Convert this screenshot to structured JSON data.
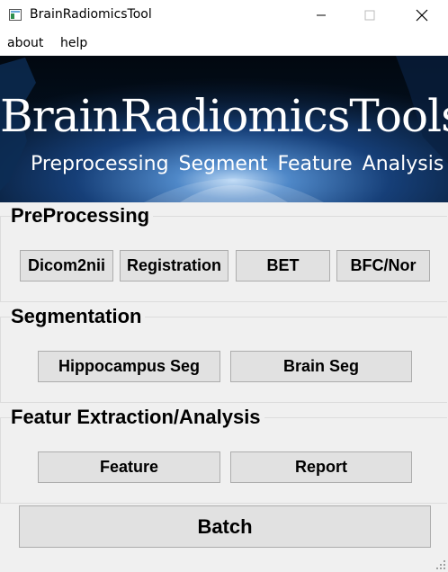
{
  "window": {
    "title": "BrainRadiomicsTool",
    "minimize_icon": "minimize-icon",
    "maximize_icon": "maximize-icon",
    "close_icon": "close-icon"
  },
  "menu": {
    "about": "about",
    "help": "help"
  },
  "banner": {
    "title": "BrainRadiomicsTools",
    "subtitle": "Preprocessing  Segment  Feature  Analysis"
  },
  "sections": {
    "preprocessing": {
      "title": "PreProcessing",
      "buttons": {
        "dicom2nii": "Dicom2nii",
        "registration": "Registration",
        "bet": "BET",
        "bfc": "BFC/Nor"
      }
    },
    "segmentation": {
      "title": "Segmentation",
      "buttons": {
        "hippocampus": "Hippocampus Seg",
        "brain": "Brain Seg"
      }
    },
    "feature": {
      "title": "Featur Extraction/Analysis",
      "buttons": {
        "feature": "Feature",
        "report": "Report"
      }
    }
  },
  "batch_label": "Batch",
  "colors": {
    "window_bg": "#f0f0f0",
    "button_bg": "#e1e1e1",
    "button_border": "#adadad",
    "banner_bg": "#0b2e5c"
  }
}
